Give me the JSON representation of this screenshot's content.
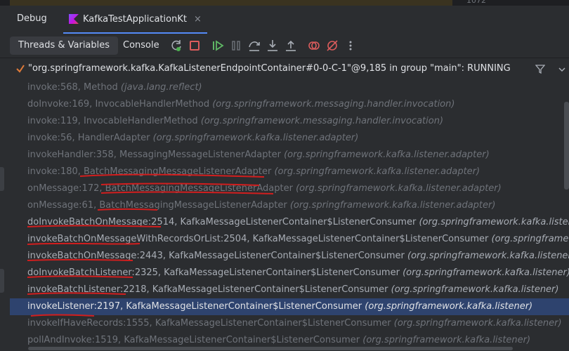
{
  "top": {
    "line_number": "1072"
  },
  "header": {
    "title": "Debug",
    "tab_label": "KafkaTestApplicationKt",
    "close_glyph": "×"
  },
  "toolbar": {
    "tab_threads": "Threads & Variables",
    "tab_console": "Console"
  },
  "thread": {
    "label": "\"org.springframework.kafka.KafkaListenerEndpointContainer#0-0-C-1\"@9,185 in group \"main\": RUNNING"
  },
  "frames": [
    {
      "method": "invoke:568, Method",
      "pkg": "(java.lang.reflect)"
    },
    {
      "method": "doInvoke:169, InvocableHandlerMethod",
      "pkg": "(org.springframework.messaging.handler.invocation)"
    },
    {
      "method": "invoke:119, InvocableHandlerMethod",
      "pkg": "(org.springframework.messaging.handler.invocation)"
    },
    {
      "method": "invoke:56, HandlerAdapter",
      "pkg": "(org.springframework.kafka.listener.adapter)"
    },
    {
      "method": "invokeHandler:358, MessagingMessageListenerAdapter",
      "pkg": "(org.springframework.kafka.listener.adapter)"
    },
    {
      "method": "invoke:180, BatchMessagingMessageListenerAdapter",
      "pkg": "(org.springframework.kafka.listener.adapter)"
    },
    {
      "method": "onMessage:172, BatchMessagingMessageListenerAdapter",
      "pkg": "(org.springframework.kafka.listener.adapter)"
    },
    {
      "method": "onMessage:61, BatchMessagingMessageListenerAdapter",
      "pkg": "(org.springframework.kafka.listener.adapter)"
    },
    {
      "method": "doInvokeBatchOnMessage:2514, KafkaMessageListenerContainer$ListenerConsumer",
      "pkg": "(org.springframework.kafka.listener)"
    },
    {
      "method": "invokeBatchOnMessageWithRecordsOrList:2504, KafkaMessageListenerContainer$ListenerConsumer",
      "pkg": "(org.springframework.kafka.listener)"
    },
    {
      "method": "invokeBatchOnMessage:2443, KafkaMessageListenerContainer$ListenerConsumer",
      "pkg": "(org.springframework.kafka.listener)"
    },
    {
      "method": "doInvokeBatchListener:2325, KafkaMessageListenerContainer$ListenerConsumer",
      "pkg": "(org.springframework.kafka.listener)"
    },
    {
      "method": "invokeBatchListener:2218, KafkaMessageListenerContainer$ListenerConsumer",
      "pkg": "(org.springframework.kafka.listener)"
    },
    {
      "method": "invokeListener:2197, KafkaMessageListenerContainer$ListenerConsumer",
      "pkg": "(org.springframework.kafka.listener)"
    },
    {
      "method": "invokeIfHaveRecords:1555, KafkaMessageListenerContainer$ListenerConsumer",
      "pkg": "(org.springframework.kafka.listener)"
    },
    {
      "method": "pollAndInvoke:1519, KafkaMessageListenerContainer$ListenerConsumer",
      "pkg": "(org.springframework.kafka.listener)"
    }
  ],
  "colors": {
    "accent": "#548af7",
    "selection": "#2e436e",
    "annotation": "#d21e1e",
    "check": "#e07b39"
  }
}
